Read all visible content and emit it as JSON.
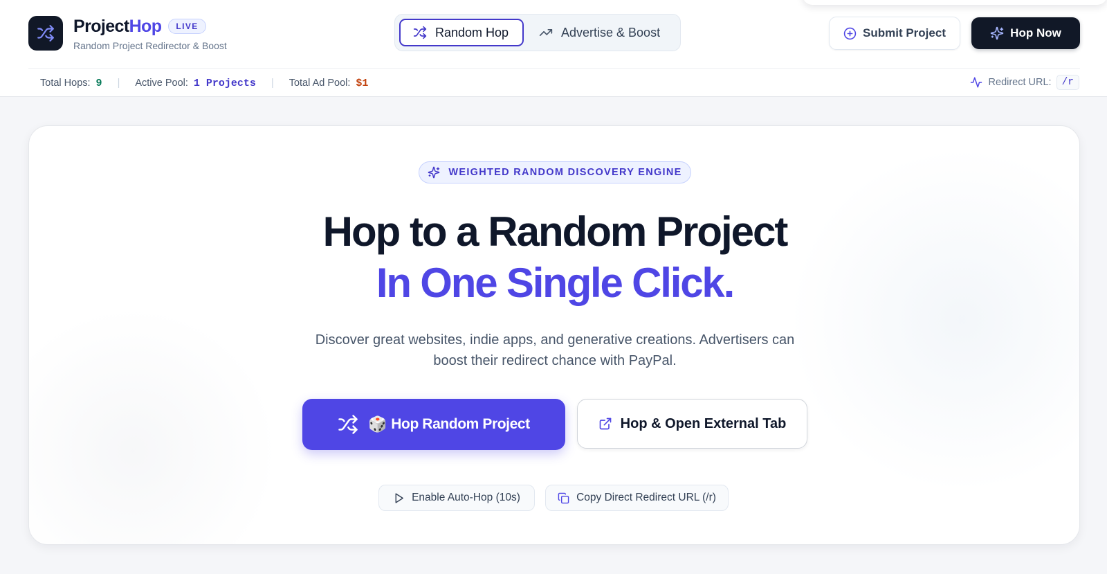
{
  "brand": {
    "name_part1": "Project",
    "name_part2": "Hop",
    "badge": "LIVE",
    "subtitle": "Random Project Redirector & Boost"
  },
  "nav": {
    "tabs": [
      {
        "label": "Random Hop",
        "icon": "shuffle-icon",
        "active": true
      },
      {
        "label": "Advertise & Boost",
        "icon": "trending-up-icon",
        "active": false
      }
    ]
  },
  "actions": {
    "submit_label": "Submit Project",
    "hop_now_label": "Hop Now"
  },
  "stats": {
    "total_hops_label": "Total Hops:",
    "total_hops_value": "9",
    "active_pool_label": "Active Pool:",
    "active_pool_value": "1 Projects",
    "ad_pool_label": "Total Ad Pool:",
    "ad_pool_value": "$1",
    "separator": "|"
  },
  "redirect": {
    "label": "Redirect URL:",
    "path": "/r"
  },
  "hero": {
    "badge": "WEIGHTED RANDOM DISCOVERY ENGINE",
    "headline_line1": "Hop to a Random Project",
    "headline_line2": "In One Single Click.",
    "description": "Discover great websites, indie apps, and generative creations. Advertisers can boost their redirect chance with PayPal.",
    "primary_dice": "🎲",
    "primary_label": "Hop Random Project",
    "secondary_label": "Hop & Open External Tab",
    "auto_hop_label": "Enable Auto-Hop (10s)",
    "copy_label": "Copy Direct Redirect URL (/r)"
  },
  "colors": {
    "accent": "#4f46e5",
    "dark": "#111827",
    "hops_green": "#047857",
    "ad_pool_orange": "#c2410c"
  }
}
